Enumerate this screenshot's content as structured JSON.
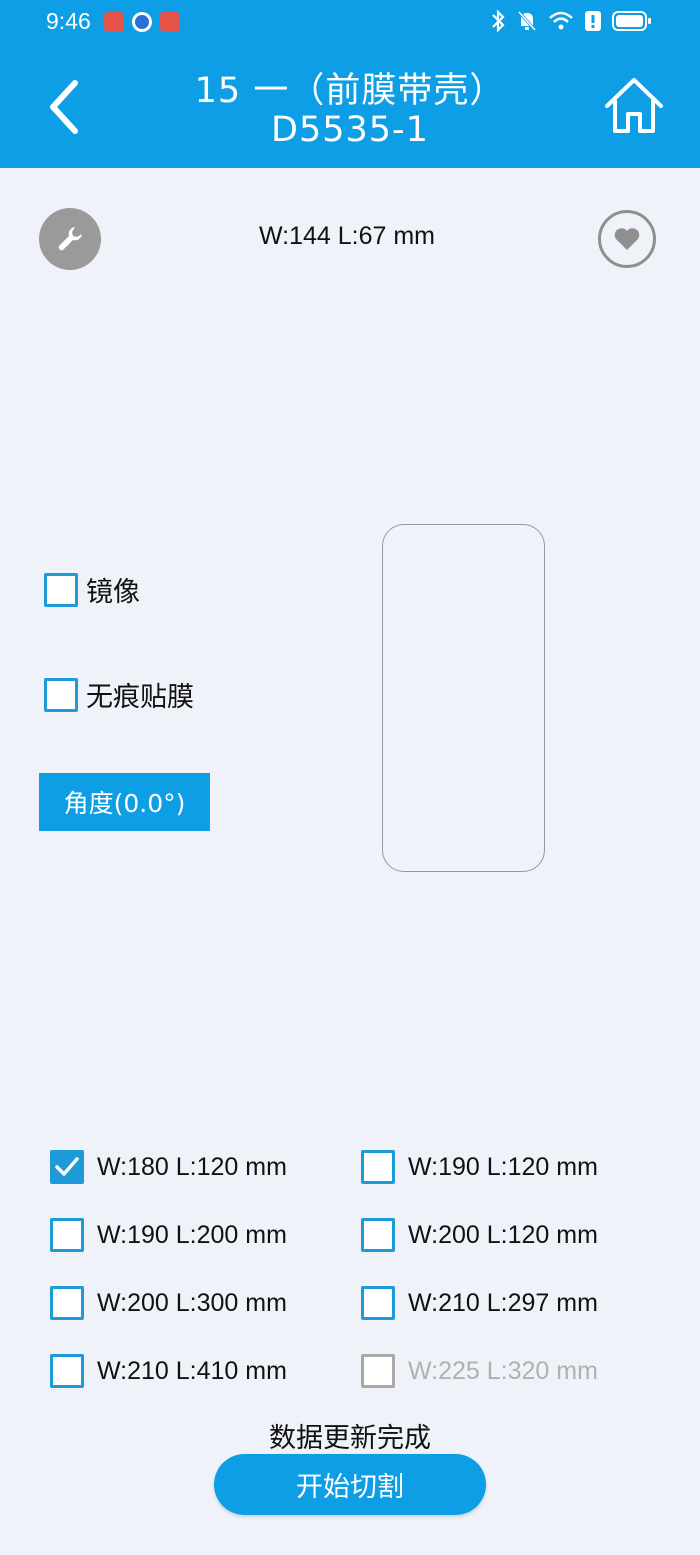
{
  "colors": {
    "primary": "#0d9ee6",
    "checkbox": "#1d9ad8",
    "background": "#eff3f9"
  },
  "status_bar": {
    "time": "9:46",
    "icons": [
      "app-red-icon",
      "browser-icon",
      "app-red-icon",
      "bluetooth-icon",
      "mute-bell-icon",
      "wifi-icon",
      "alert-icon",
      "battery-icon"
    ]
  },
  "header": {
    "title_line1": "15 一（前膜带壳）",
    "title_line2": "D5535-1",
    "back_icon": "chevron-left-icon",
    "home_icon": "home-icon"
  },
  "info": {
    "dimensions": "W:144 L:67 mm"
  },
  "options": [
    {
      "label": "镜像",
      "checked": false
    },
    {
      "label": "无痕贴膜",
      "checked": false
    }
  ],
  "angle_button": {
    "label": "角度(0.0°)"
  },
  "sizes": [
    {
      "label": "W:180 L:120 mm",
      "checked": true,
      "disabled": false
    },
    {
      "label": "W:190 L:120 mm",
      "checked": false,
      "disabled": false
    },
    {
      "label": "W:190 L:200 mm",
      "checked": false,
      "disabled": false
    },
    {
      "label": "W:200 L:120 mm",
      "checked": false,
      "disabled": false
    },
    {
      "label": "W:200 L:300 mm",
      "checked": false,
      "disabled": false
    },
    {
      "label": "W:210 L:297 mm",
      "checked": false,
      "disabled": false
    },
    {
      "label": "W:210 L:410 mm",
      "checked": false,
      "disabled": false
    },
    {
      "label": "W:225 L:320 mm",
      "checked": false,
      "disabled": true
    }
  ],
  "footer": {
    "status_message": "数据更新完成",
    "start_button": "开始切割"
  }
}
